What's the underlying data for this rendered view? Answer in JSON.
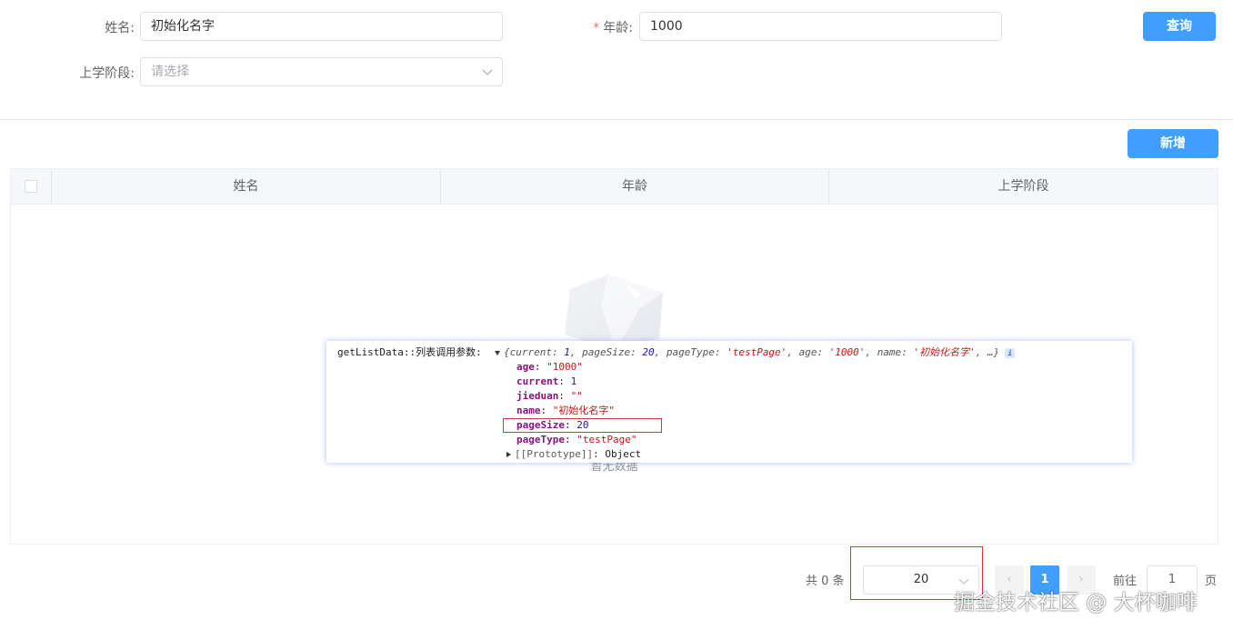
{
  "form": {
    "name_label": "姓名:",
    "name_value": "初始化名字",
    "age_required_mark": "*",
    "age_label": "年龄:",
    "age_value": "1000",
    "stage_label": "上学阶段:",
    "stage_placeholder": "请选择",
    "query_button": "查询"
  },
  "toolbar": {
    "add_button": "新增"
  },
  "table": {
    "columns": [
      "姓名",
      "年龄",
      "上学阶段"
    ],
    "empty_text": "暂无数据"
  },
  "console": {
    "label": "getListData::列表调用参数:",
    "summary": {
      "prefix": "{",
      "k1": "current",
      "v1": "1",
      "k2": "pageSize",
      "v2": "20",
      "k3": "pageType",
      "v3": "'testPage'",
      "k4": "age",
      "v4": "'1000'",
      "k5": "name",
      "v5": "'初始化名字'",
      "suffix": ", …}"
    },
    "info_icon": "i",
    "props": [
      {
        "key": "age",
        "value": "\"1000\"",
        "kind": "str"
      },
      {
        "key": "current",
        "value": "1",
        "kind": "num"
      },
      {
        "key": "jieduan",
        "value": "\"\"",
        "kind": "str"
      },
      {
        "key": "name",
        "value": "\"初始化名字\"",
        "kind": "str"
      },
      {
        "key": "pageSize",
        "value": "20",
        "kind": "num"
      },
      {
        "key": "pageType",
        "value": "\"testPage\"",
        "kind": "str"
      }
    ],
    "prototype_key": "[[Prototype]]",
    "prototype_value": "Object"
  },
  "pagination": {
    "total": "共 0 条",
    "page_size": "20",
    "prev": "‹",
    "current_page": "1",
    "next": "›",
    "goto_label": "前往",
    "goto_value": "1",
    "page_unit": "页"
  },
  "watermark": "掘金技术社区 @ 大杯咖啡",
  "colors": {
    "primary": "#409eff",
    "highlight": "#d9363e",
    "required": "#f56c6c"
  }
}
